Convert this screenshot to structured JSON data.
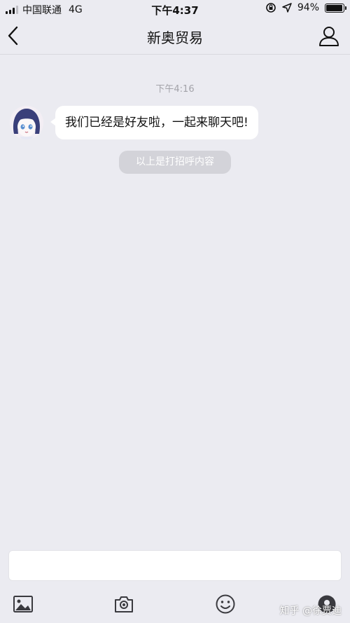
{
  "status_bar": {
    "carrier": "中国联通",
    "network": "4G",
    "time": "下午4:37",
    "battery_percent": "94%",
    "battery_level": 0.94
  },
  "nav": {
    "title": "新奥贸易",
    "back_icon": "chevron-left-icon",
    "profile_icon": "person-icon"
  },
  "chat": {
    "timestamp": "下午4:16",
    "messages": [
      {
        "text": "我们已经是好友啦，一起来聊天吧!"
      }
    ],
    "system_notice": "以上是打招呼内容"
  },
  "input": {
    "placeholder": ""
  },
  "toolbar": {
    "icons": [
      "image-icon",
      "camera-icon",
      "emoji-icon",
      "more-icon"
    ]
  },
  "watermark": "知乎 @徐贾迪",
  "colors": {
    "background": "#ebebf1",
    "bubble": "#ffffff",
    "pill": "#d3d3d9",
    "timestamp": "#a3a3a9"
  }
}
